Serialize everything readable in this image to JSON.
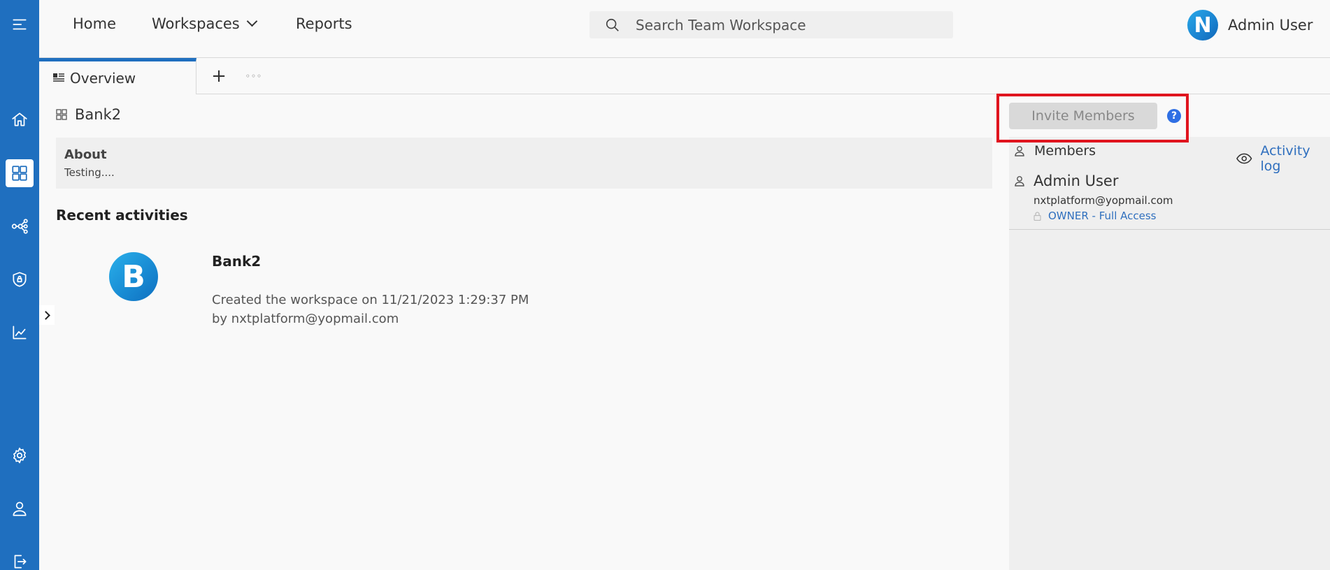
{
  "sidebar": {
    "icons": [
      {
        "name": "menu-icon"
      },
      {
        "name": "home-icon"
      },
      {
        "name": "workspaces-icon"
      },
      {
        "name": "network-icon"
      },
      {
        "name": "shield-icon"
      },
      {
        "name": "analytics-icon"
      },
      {
        "name": "gear-icon"
      },
      {
        "name": "user-icon"
      },
      {
        "name": "logout-icon"
      }
    ],
    "active": "workspaces-icon",
    "color": "#1f6fbf"
  },
  "header": {
    "nav": {
      "home": "Home",
      "workspaces": "Workspaces",
      "reports": "Reports"
    },
    "search": {
      "placeholder": "Search Team Workspace"
    },
    "user": {
      "avatar_letter": "N",
      "name": "Admin User"
    }
  },
  "tabs": {
    "overview": "Overview",
    "add": "+",
    "more": "◦◦◦"
  },
  "workspace": {
    "name": "Bank2",
    "about": {
      "title": "About",
      "text": "Testing...."
    }
  },
  "recent": {
    "title": "Recent activities",
    "items": [
      {
        "logo_letter": "B",
        "name": "Bank2",
        "line1": "Created the workspace on 11/21/2023 1:29:37 PM",
        "line2": "by nxtplatform@yopmail.com"
      }
    ]
  },
  "members_panel": {
    "invite_label": "Invite Members",
    "help": "?",
    "members_title": "Members",
    "activity_log": "Activity log",
    "members": [
      {
        "name": "Admin User",
        "email": "nxtplatform@yopmail.com",
        "role": "OWNER - Full Access"
      }
    ],
    "highlight_color": "#e0141e"
  }
}
